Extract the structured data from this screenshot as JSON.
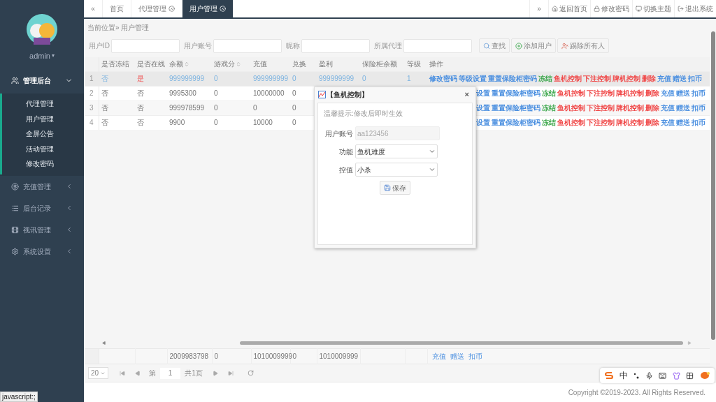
{
  "sidebar": {
    "user": "admin",
    "caret": "▾",
    "menu": [
      {
        "label": "管理后台",
        "expanded": true,
        "children": [
          {
            "label": "代理管理"
          },
          {
            "label": "用户管理"
          },
          {
            "label": "全屏公告"
          },
          {
            "label": "活动管理"
          },
          {
            "label": "修改密码"
          }
        ]
      },
      {
        "label": "充值管理",
        "expanded": false
      },
      {
        "label": "后台记录",
        "expanded": false
      },
      {
        "label": "视讯管理",
        "expanded": false
      },
      {
        "label": "系统设置",
        "expanded": false
      }
    ]
  },
  "tabs": {
    "prev": "«",
    "next": "»",
    "items": [
      {
        "label": "首页",
        "selected": false,
        "closable": false
      },
      {
        "label": "代理管理",
        "selected": false,
        "closable": true
      },
      {
        "label": "用户管理",
        "selected": true,
        "closable": true
      }
    ],
    "actions": [
      {
        "kind": "home",
        "label": "返回首页"
      },
      {
        "kind": "lock",
        "label": "修改密码"
      },
      {
        "kind": "theme",
        "label": "切换主题"
      },
      {
        "kind": "logout",
        "label": "退出系统"
      }
    ]
  },
  "breadcrumb": "当前位置» 用户管理",
  "search": {
    "fields": [
      {
        "label": "用户ID"
      },
      {
        "label": "用户账号"
      },
      {
        "label": "昵称"
      },
      {
        "label": "所属代理"
      }
    ],
    "buttons": [
      {
        "kind": "search",
        "label": "查找"
      },
      {
        "kind": "add",
        "label": "添加用户"
      },
      {
        "kind": "kick",
        "label": "踢除所有人"
      }
    ]
  },
  "table": {
    "columns": [
      {
        "label": "是否冻结",
        "sortable": false
      },
      {
        "label": "是否在线",
        "sortable": false
      },
      {
        "label": "余额",
        "sortable": true
      },
      {
        "label": "游戏分",
        "sortable": true
      },
      {
        "label": "充值",
        "sortable": false
      },
      {
        "label": "兑换",
        "sortable": false
      },
      {
        "label": "盈利",
        "sortable": false
      },
      {
        "label": "保险柜余额",
        "sortable": false
      },
      {
        "label": "等级",
        "sortable": false
      },
      {
        "label": "操作",
        "sortable": false
      }
    ],
    "rows": [
      {
        "index": "1",
        "selected": true,
        "online_flag": true,
        "cells": [
          "否",
          "是",
          "999999999",
          "0",
          "999999999",
          "0",
          "999999999",
          "0",
          "1"
        ],
        "ops_cut": false,
        "ops": [
          {
            "label": "修改密码",
            "color": "#4a8fe0"
          },
          {
            "label": "等级设置",
            "color": "#4a8fe0"
          },
          {
            "label": "重置保险柜密码",
            "color": "#4a8fe0"
          },
          {
            "label": "冻结",
            "color": "#3aa64a"
          },
          {
            "label": "鱼机控制",
            "color": "#f04848"
          },
          {
            "label": "下注控制",
            "color": "#f04848"
          },
          {
            "label": "牌机控制",
            "color": "#f04848"
          },
          {
            "label": "删除",
            "color": "#f04848"
          },
          {
            "label": "充值",
            "color": "#4a8fe0"
          },
          {
            "label": "赠送",
            "color": "#4a8fe0"
          },
          {
            "label": "扣币",
            "color": "#4a8fe0"
          }
        ]
      },
      {
        "index": "2",
        "selected": false,
        "online_flag": false,
        "cells": [
          "否",
          "否",
          "9995300",
          "0",
          "10000000",
          "0"
        ],
        "ops_cut": true,
        "ops": [
          {
            "label": "设置",
            "color": "#4a8fe0"
          },
          {
            "label": "重置保险柜密码",
            "color": "#4a8fe0"
          },
          {
            "label": "冻结",
            "color": "#3aa64a"
          },
          {
            "label": "鱼机控制",
            "color": "#f04848"
          },
          {
            "label": "下注控制",
            "color": "#f04848"
          },
          {
            "label": "牌机控制",
            "color": "#f04848"
          },
          {
            "label": "删除",
            "color": "#f04848"
          },
          {
            "label": "充值",
            "color": "#4a8fe0"
          },
          {
            "label": "赠送",
            "color": "#4a8fe0"
          },
          {
            "label": "扣币",
            "color": "#4a8fe0"
          }
        ]
      },
      {
        "index": "3",
        "selected": false,
        "online_flag": false,
        "cells": [
          "否",
          "否",
          "999978599",
          "0",
          "0",
          "0"
        ],
        "ops_cut": true,
        "ops": [
          {
            "label": "设置",
            "color": "#4a8fe0"
          },
          {
            "label": "重置保险柜密码",
            "color": "#4a8fe0"
          },
          {
            "label": "冻结",
            "color": "#3aa64a"
          },
          {
            "label": "鱼机控制",
            "color": "#f04848"
          },
          {
            "label": "下注控制",
            "color": "#f04848"
          },
          {
            "label": "牌机控制",
            "color": "#f04848"
          },
          {
            "label": "删除",
            "color": "#f04848"
          },
          {
            "label": "充值",
            "color": "#4a8fe0"
          },
          {
            "label": "赠送",
            "color": "#4a8fe0"
          },
          {
            "label": "扣币",
            "color": "#4a8fe0"
          }
        ]
      },
      {
        "index": "4",
        "selected": false,
        "online_flag": false,
        "cells": [
          "否",
          "否",
          "9900",
          "0",
          "10000",
          "0"
        ],
        "ops_cut": true,
        "ops": [
          {
            "label": "设置",
            "color": "#4a8fe0"
          },
          {
            "label": "重置保险柜密码",
            "color": "#4a8fe0"
          },
          {
            "label": "冻结",
            "color": "#3aa64a"
          },
          {
            "label": "鱼机控制",
            "color": "#f04848"
          },
          {
            "label": "下注控制",
            "color": "#f04848"
          },
          {
            "label": "牌机控制",
            "color": "#f04848"
          },
          {
            "label": "删除",
            "color": "#f04848"
          },
          {
            "label": "充值",
            "color": "#4a8fe0"
          },
          {
            "label": "赠送",
            "color": "#4a8fe0"
          },
          {
            "label": "扣币",
            "color": "#4a8fe0"
          }
        ]
      }
    ],
    "footer": {
      "cells": [
        "",
        "",
        "2009983798",
        "0",
        "1010009999",
        "0",
        "1010009999",
        "",
        ""
      ],
      "ops": [
        "充值",
        "赠送",
        "扣币"
      ]
    }
  },
  "pagination": {
    "page_size": "20",
    "page_prefix": "第",
    "page": "1",
    "page_total": "共1页"
  },
  "copyright": "Copyright ©2019-2023. All Rights Reserved.",
  "dialog": {
    "title": "【鱼机控制】",
    "close": "×",
    "hint": "温馨提示:修改后即时生效",
    "fields": [
      {
        "kind": "input",
        "label": "用户账号",
        "value": "aa123456",
        "disabled": true
      },
      {
        "kind": "select",
        "label": "功能",
        "value": "鱼机难度"
      },
      {
        "kind": "select",
        "label": "控值",
        "value": "小杀"
      }
    ],
    "save": "保存"
  },
  "ime": {
    "lang": "中"
  },
  "status_link": "javascript:;"
}
